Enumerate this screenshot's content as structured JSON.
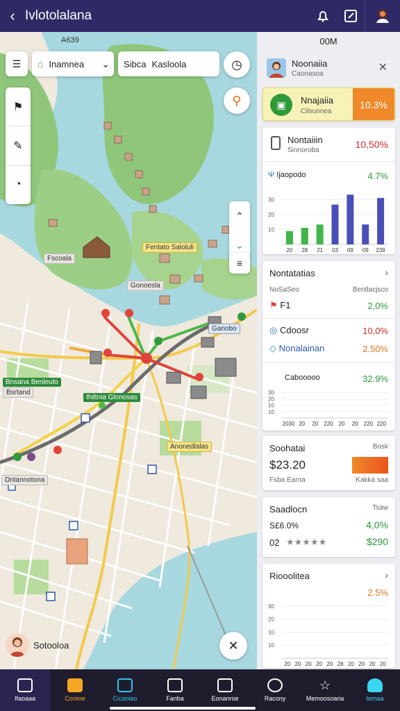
{
  "topbar": {
    "title": "Ivlotolalana"
  },
  "map": {
    "top_label": "A639",
    "location_select": "Inamnea",
    "search_prefix": "Sibca",
    "search_value": "Kasloola",
    "labels": [
      {
        "text": "Fentato Saloluli",
        "style": "yellow"
      },
      {
        "text": "Fscoala",
        "style": "gray"
      },
      {
        "text": "Gonoesla",
        "style": "gray"
      },
      {
        "text": "Ganobo",
        "style": "blue"
      },
      {
        "text": "Bnsana Benleulo",
        "style": "green"
      },
      {
        "text": "Bsrtand",
        "style": "gray"
      },
      {
        "text": "Ihiltnia Glonosas",
        "style": "green"
      },
      {
        "text": "Anonedlalas",
        "style": "yellow"
      },
      {
        "text": "Dntannotona",
        "style": "gray"
      }
    ],
    "user_label": "Sotooloa"
  },
  "panel": {
    "header": "00M",
    "profile": {
      "name": "Noonaiia",
      "sub": "Caonasoa"
    },
    "highlight": {
      "title": "Nnajaiia",
      "sub": "Cilsunnea",
      "value": "10.3%"
    },
    "stats_card": {
      "title": "Nontaiiin",
      "sub": "Sinnoroba",
      "pct": "10,50%",
      "chart_title": "Ijaopodo",
      "chart_pct": "4.7%"
    },
    "list_card": {
      "title": "Nontatatias",
      "col_left": "NoSaSeo",
      "col_right": "Bentlacjsco",
      "items": [
        {
          "label": "F1",
          "value": "2,0%",
          "color": "green"
        },
        {
          "label": "Cdoosr",
          "value": "10,0%",
          "color": "red"
        },
        {
          "label": "Nonalainan",
          "value": "2.50%",
          "color": "orange"
        }
      ],
      "chart_title": "Cabooooo",
      "chart_pct": "32.9%"
    },
    "amount_card": {
      "title": "Soohatai",
      "corner": "Bosk",
      "amount": "$23.20",
      "sub": "Fsba Earna",
      "sub_right": "Kakka saa"
    },
    "rating_card": {
      "title": "Saadlocn",
      "corner": "Tsaw",
      "line1": "S£6.0%",
      "line1_value": "4,0%",
      "line2": "02",
      "line2_value": "$290",
      "stars": "★★★★★"
    },
    "bottom_card": {
      "title": "Riooolitea",
      "pct": "2.5%"
    }
  },
  "chart_data": [
    {
      "type": "bar",
      "title": "Ijaopodo",
      "categories": [
        "20",
        "28",
        "21",
        "03",
        "09",
        "09",
        "239"
      ],
      "yticks": [
        "30",
        "20",
        "10"
      ],
      "series": [
        {
          "values": [
            8,
            10,
            12,
            0,
            0,
            0,
            0
          ]
        },
        {
          "values": [
            0,
            0,
            0,
            24,
            30,
            12,
            28
          ]
        }
      ]
    },
    {
      "type": "bar",
      "title": "Cabooooo",
      "categories": [
        "2030",
        "20",
        "20",
        "220",
        "20",
        "20",
        "220",
        "220"
      ],
      "yticks": [
        "30",
        "20",
        "10",
        "10"
      ]
    },
    {
      "type": "bar",
      "title": "Riooolitea",
      "categories": [
        "20",
        "20",
        "20",
        "20",
        "20",
        "28",
        "20",
        "20",
        "20",
        "20"
      ],
      "yticks": [
        "30",
        "20",
        "10",
        "10"
      ]
    }
  ],
  "bottomnav": {
    "items": [
      "Ifaoaaa",
      "Coreoe",
      "Cicaoiao",
      "Fanba",
      "Eonanroe",
      "Racony",
      "Memoosoaria",
      "Iemaa"
    ]
  }
}
